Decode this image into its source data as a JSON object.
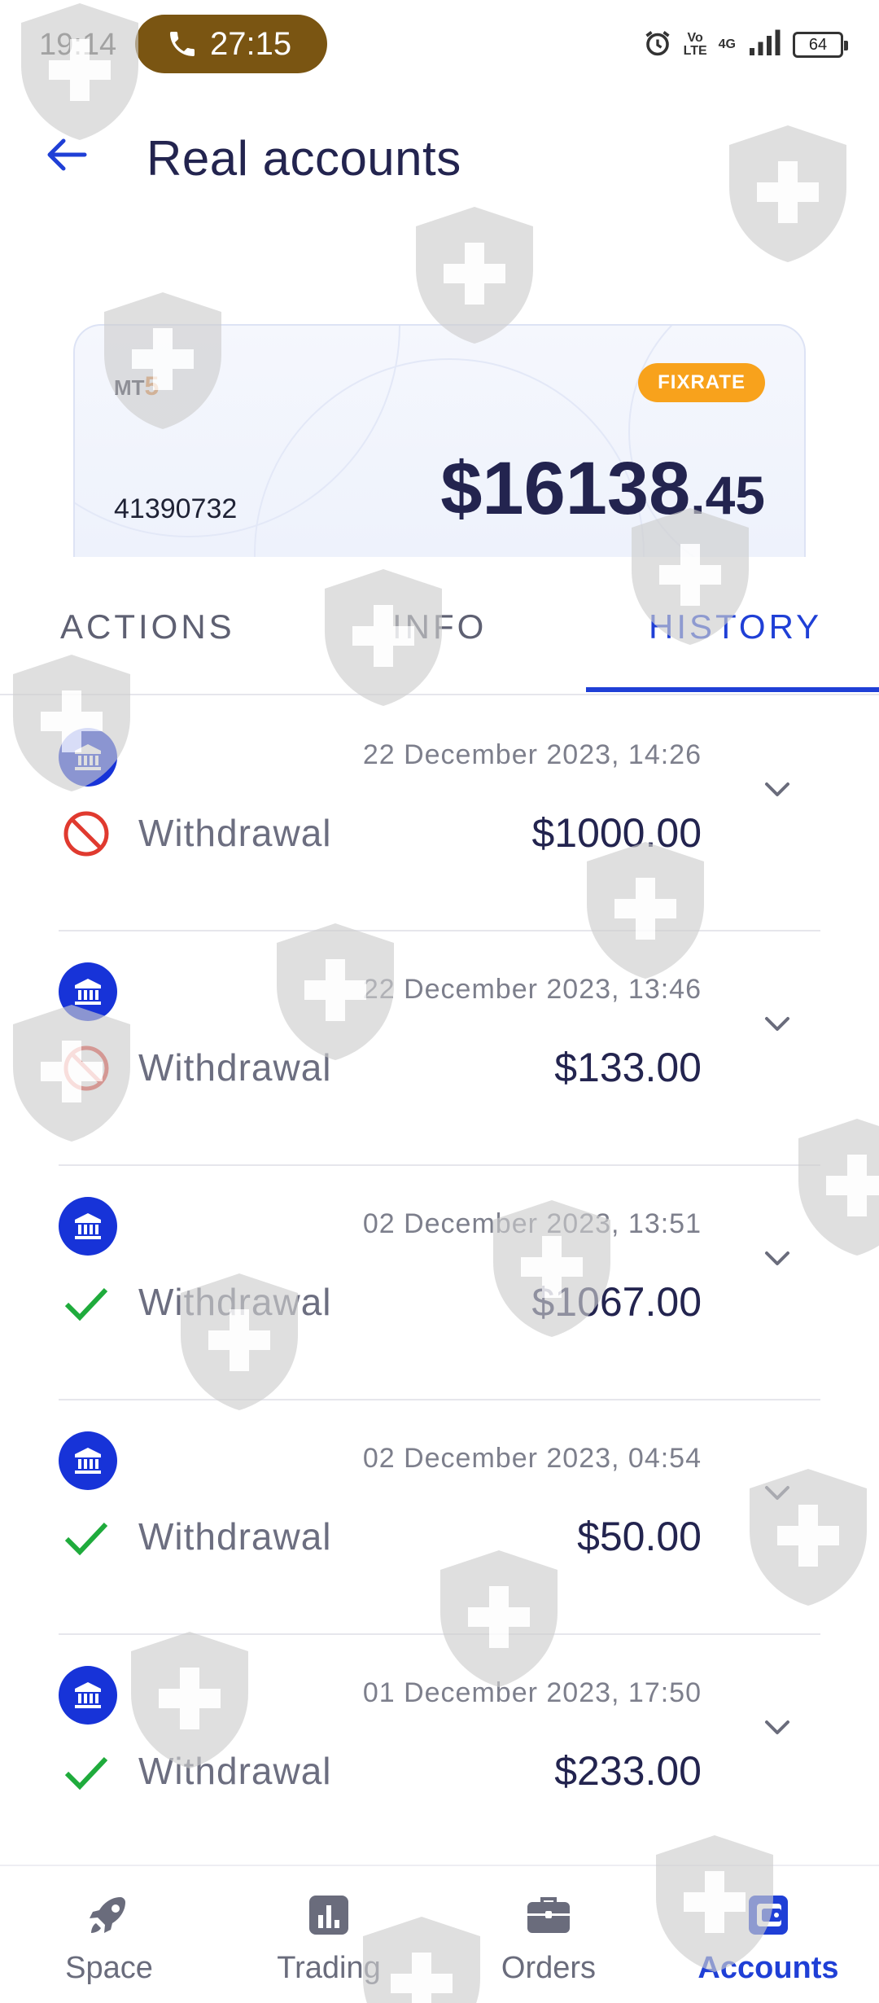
{
  "status_bar": {
    "time": "19:14",
    "call_timer": "27:15",
    "volte_line1": "Vo",
    "volte_line2": "LTE",
    "network": "4G",
    "battery": "64",
    "icons": [
      "phone-icon",
      "alarm-icon",
      "signal-icon",
      "battery-icon"
    ]
  },
  "header": {
    "title": "Real accounts",
    "back_icon": "arrow-left-icon"
  },
  "account_card": {
    "platform": "MT",
    "platform_version": "5",
    "badge": "FIXRATE",
    "account_number": "41390732",
    "balance_main": "$16138",
    "balance_cents": ".45"
  },
  "tabs": [
    {
      "label": "ACTIONS",
      "active": false
    },
    {
      "label": "INFO",
      "active": false
    },
    {
      "label": "HISTORY",
      "active": true
    }
  ],
  "transactions": [
    {
      "date": "22 December 2023, 14:26",
      "type": "Withdrawal",
      "amount": "$1000.00",
      "status": "rejected"
    },
    {
      "date": "22 December 2023, 13:46",
      "type": "Withdrawal",
      "amount": "$133.00",
      "status": "rejected"
    },
    {
      "date": "02 December 2023, 13:51",
      "type": "Withdrawal",
      "amount": "$1067.00",
      "status": "completed"
    },
    {
      "date": "02 December 2023, 04:54",
      "type": "Withdrawal",
      "amount": "$50.00",
      "status": "completed"
    },
    {
      "date": "01 December 2023, 17:50",
      "type": "Withdrawal",
      "amount": "$233.00",
      "status": "completed"
    }
  ],
  "bottom_nav": [
    {
      "label": "Space",
      "icon": "rocket-icon",
      "active": false
    },
    {
      "label": "Trading",
      "icon": "chart-icon",
      "active": false
    },
    {
      "label": "Orders",
      "icon": "briefcase-icon",
      "active": false
    },
    {
      "label": "Accounts",
      "icon": "wallet-icon",
      "active": true
    }
  ],
  "colors": {
    "accent": "#1f3fd6",
    "bank_icon": "#1733d8",
    "badge": "#f8a21c",
    "call_pill": "#7a5512",
    "rejected": "#e03a2f",
    "completed": "#1fab3c"
  }
}
